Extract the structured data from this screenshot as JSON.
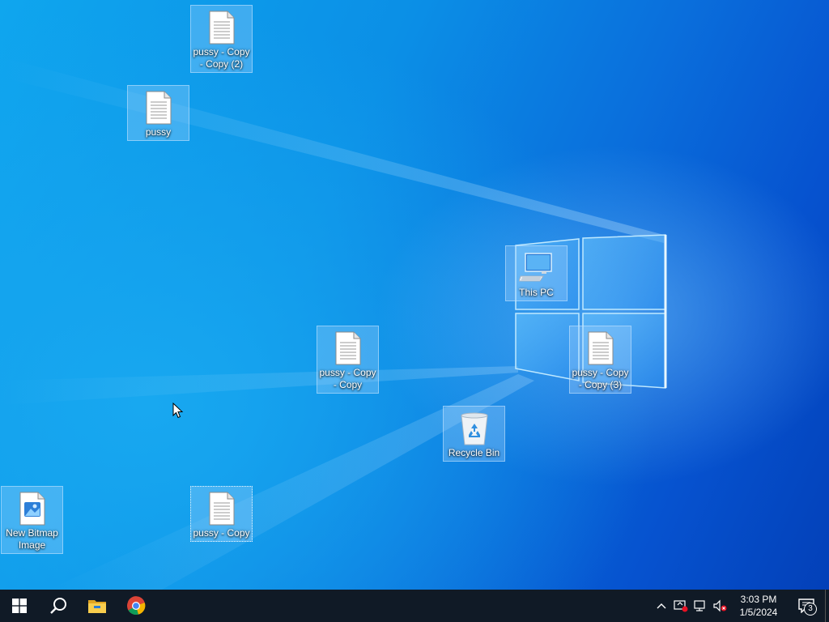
{
  "desktop": {
    "icons": [
      {
        "label": "pussy - Copy - Copy (2)",
        "icon": "text-document-icon"
      },
      {
        "label": "pussy",
        "icon": "text-document-icon"
      },
      {
        "label": "This PC",
        "icon": "computer-icon"
      },
      {
        "label": "pussy - Copy - Copy",
        "icon": "text-document-icon"
      },
      {
        "label": "pussy - Copy - Copy (3)",
        "icon": "text-document-icon"
      },
      {
        "label": "Recycle Bin",
        "icon": "recycle-bin-icon"
      },
      {
        "label": "New Bitmap Image",
        "icon": "bitmap-image-icon"
      },
      {
        "label": "pussy - Copy",
        "icon": "text-document-icon"
      }
    ],
    "wallpaper": {
      "accent": "#0a6fdc",
      "logo_glow": "#9fd8ff"
    }
  },
  "taskbar": {
    "background": "#101a26",
    "pinned": [
      {
        "name": "start-button",
        "icon": "windows-logo-icon"
      },
      {
        "name": "search-button",
        "icon": "search-icon"
      },
      {
        "name": "file-explorer",
        "icon": "folder-icon"
      },
      {
        "name": "chrome",
        "icon": "chrome-icon"
      }
    ],
    "tray": {
      "icons": [
        "chevron-up-icon",
        "security-alert-icon",
        "network-disconnected-icon",
        "volume-muted-icon"
      ],
      "time": "3:03 PM",
      "date": "1/5/2024",
      "notification_count": "3"
    }
  }
}
